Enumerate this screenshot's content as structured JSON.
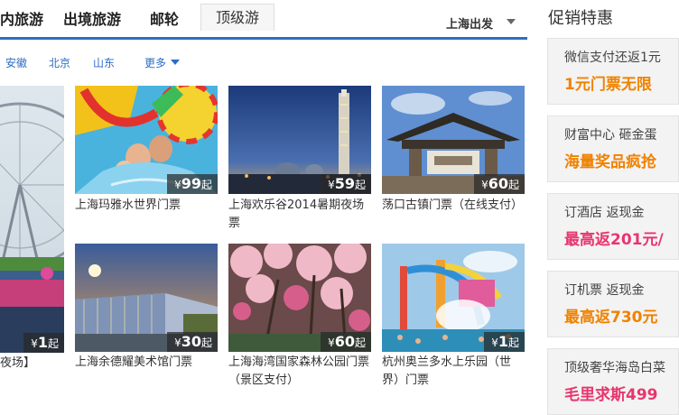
{
  "nav": {
    "tabs": [
      "内旅游",
      "出境旅游",
      "邮轮"
    ],
    "active_tab": "顶级游",
    "departure": "上海出发"
  },
  "cities": [
    "安徽",
    "北京",
    "山东",
    "更多"
  ],
  "products": [
    {
      "title": "夜场】",
      "price": "1",
      "currency": "¥",
      "suffix": "起"
    },
    {
      "title": "上海玛雅水世界门票",
      "price": "99",
      "currency": "¥",
      "suffix": "起"
    },
    {
      "title": "上海欢乐谷2014暑期夜场票",
      "price": "59",
      "currency": "¥",
      "suffix": "起"
    },
    {
      "title": "荡口古镇门票（在线支付）",
      "price": "60",
      "currency": "¥",
      "suffix": "起"
    },
    {
      "title": "上海余德耀美术馆门票",
      "price": "30",
      "currency": "¥",
      "suffix": "起"
    },
    {
      "title": "上海海湾国家森林公园门票（景区支付）",
      "price": "60",
      "currency": "¥",
      "suffix": "起"
    },
    {
      "title": "杭州奥兰多水上乐园（世界）门票",
      "price": "1",
      "currency": "¥",
      "suffix": "起"
    }
  ],
  "promotions": {
    "title": "促销特惠",
    "items": [
      {
        "line1": "微信支付还返1元",
        "line2": "1元门票无限",
        "color": "#f08200"
      },
      {
        "line1": "财富中心  砸金蛋",
        "line2": "海量奖品疯抢",
        "color": "#f08200"
      },
      {
        "line1": "订酒店  返现金",
        "line2": "最高返201元/",
        "color": "#e8356e"
      },
      {
        "line1": "订机票  返现金",
        "line2": "最高返730元",
        "color": "#f08200"
      },
      {
        "line1": "顶级奢华海岛白菜",
        "line2": "毛里求斯499",
        "color": "#e8356e"
      }
    ]
  },
  "colors": {
    "accent_blue": "#2e6fc0",
    "link_blue": "#2b6cc4"
  }
}
